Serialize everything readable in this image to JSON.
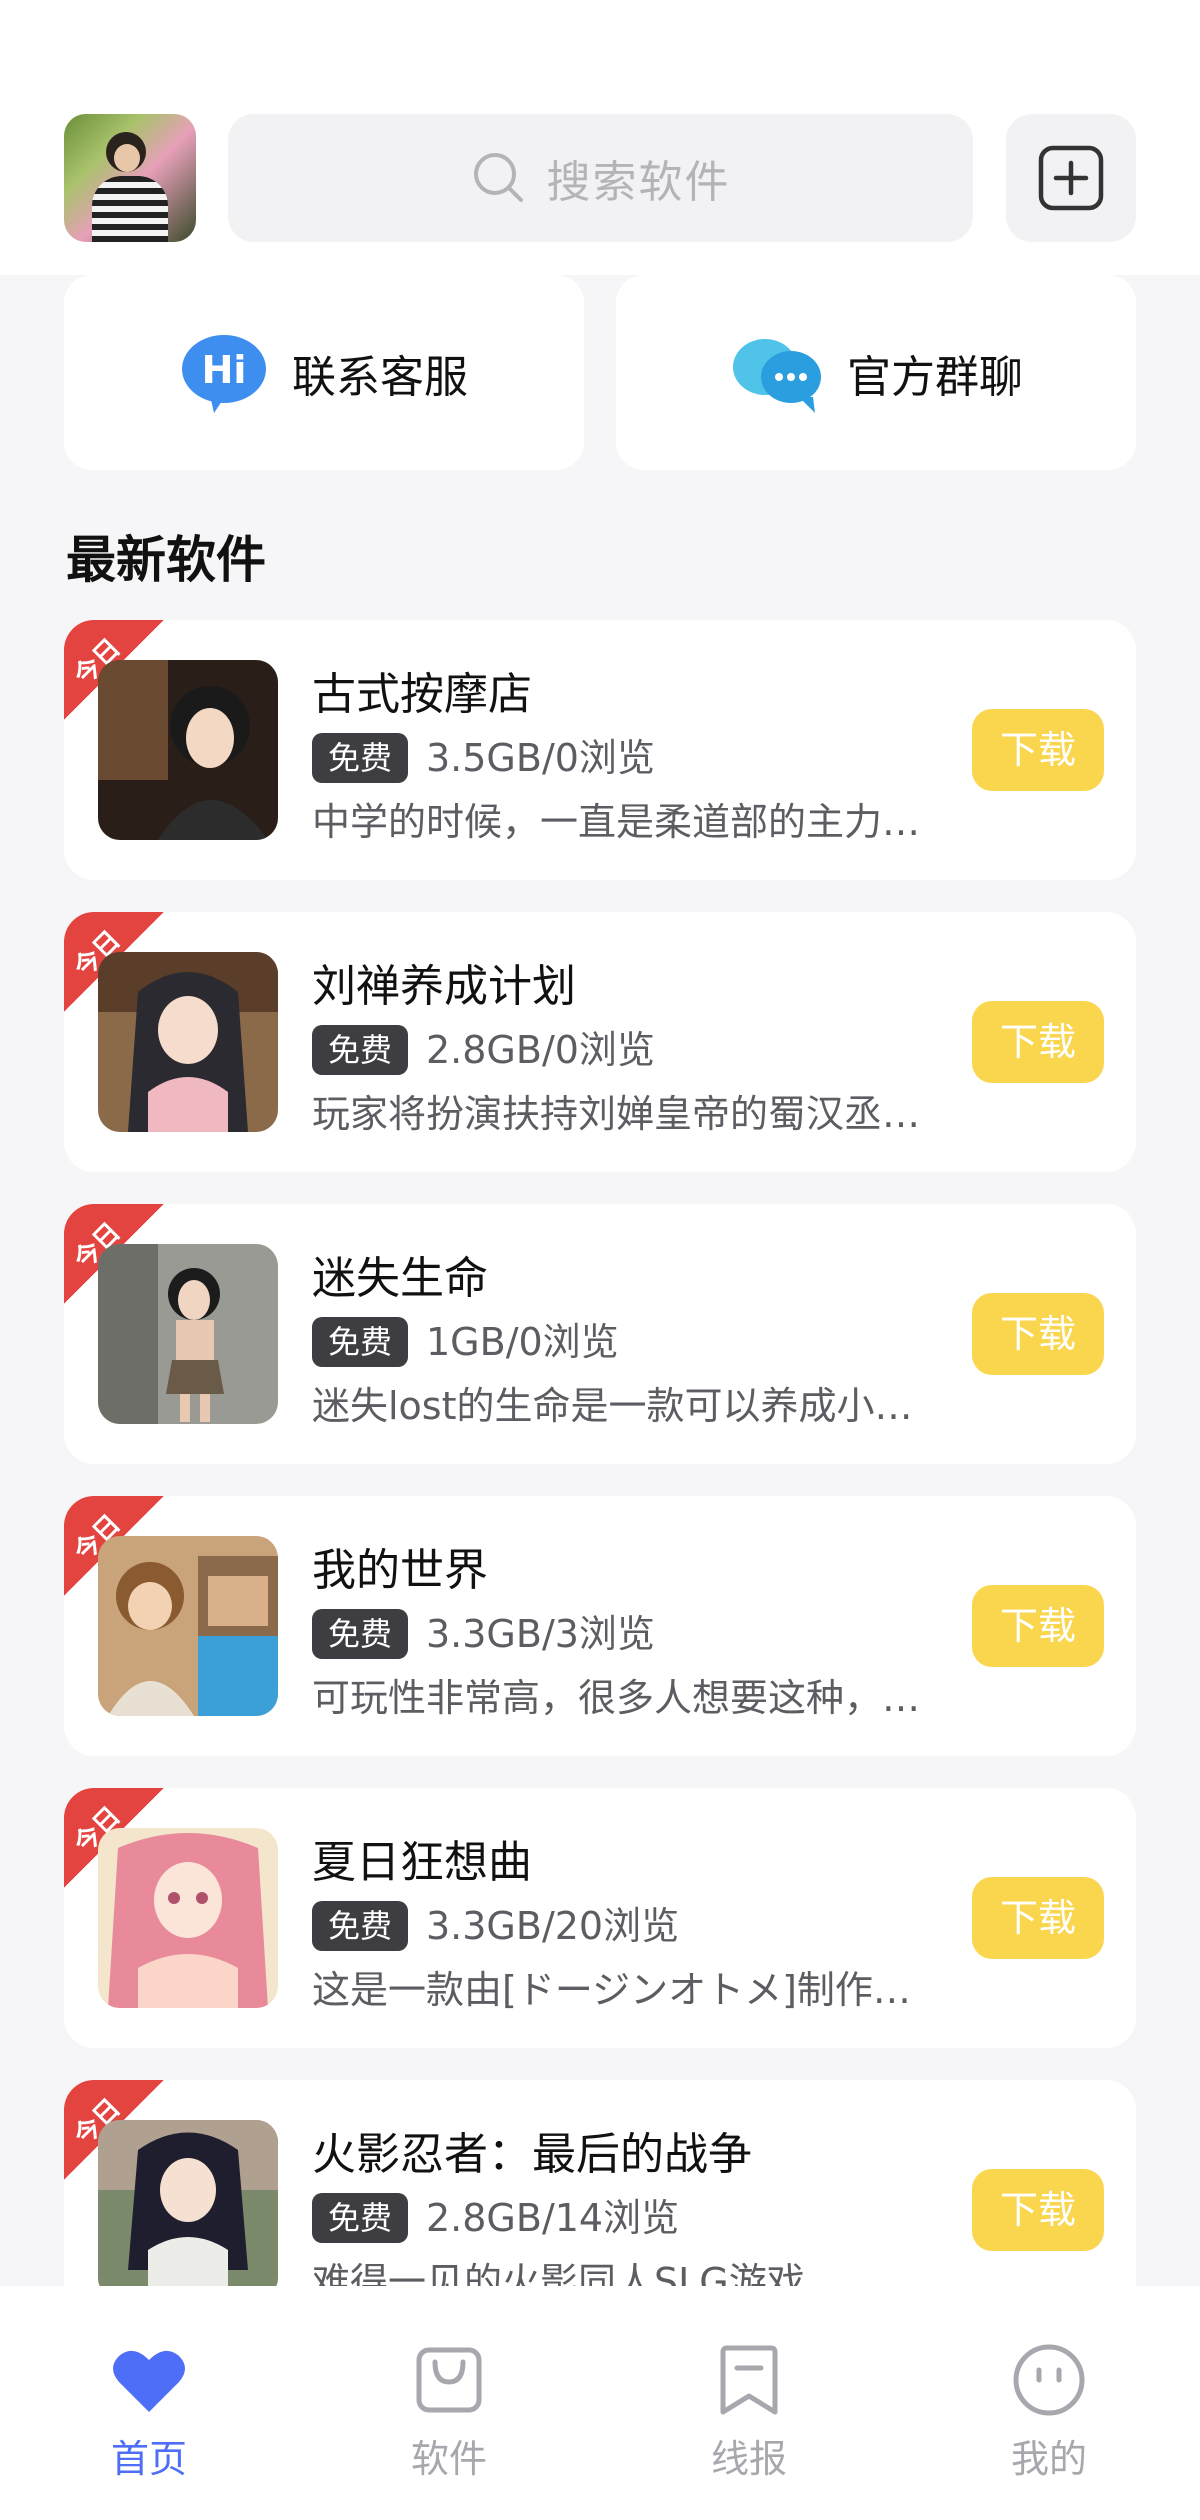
{
  "header": {
    "search_placeholder": "搜索软件"
  },
  "services": [
    {
      "label": "联系客服",
      "icon": "hi-chat-bubble-icon"
    },
    {
      "label": "官方群聊",
      "icon": "group-chat-bubbles-icon"
    }
  ],
  "section": {
    "title": "最新软件"
  },
  "items": [
    {
      "badge_corner": "今日",
      "title": "古式按摩店",
      "tag": "免费",
      "meta": "3.5GB/0浏览",
      "desc": "中学的时候，一直是柔道部的主力…",
      "button": "下载"
    },
    {
      "badge_corner": "今日",
      "title": "刘禅养成计划",
      "tag": "免费",
      "meta": "2.8GB/0浏览",
      "desc": "玩家将扮演扶持刘婵皇帝的蜀汉丞…",
      "button": "下载"
    },
    {
      "badge_corner": "今日",
      "title": "迷失生命",
      "tag": "免费",
      "meta": "1GB/0浏览",
      "desc": "迷失lost的生命是一款可以养成小…",
      "button": "下载"
    },
    {
      "badge_corner": "今日",
      "title": "我的世界",
      "tag": "免费",
      "meta": "3.3GB/3浏览",
      "desc": "可玩性非常高，很多人想要这种，…",
      "button": "下载"
    },
    {
      "badge_corner": "今日",
      "title": "夏日狂想曲",
      "tag": "免费",
      "meta": "3.3GB/20浏览",
      "desc": "这是一款由[ドージンオトメ]制作…",
      "button": "下载"
    },
    {
      "badge_corner": "今日",
      "title": "火影忍者：最后的战争",
      "tag": "免费",
      "meta": "2.8GB/14浏览",
      "desc": "难得一见的火影同人SLG游戏",
      "button": "下载"
    }
  ],
  "tabbar": [
    {
      "label": "首页",
      "icon": "heart-icon",
      "active": true
    },
    {
      "label": "软件",
      "icon": "bag-icon",
      "active": false
    },
    {
      "label": "线报",
      "icon": "bookmark-icon",
      "active": false
    },
    {
      "label": "我的",
      "icon": "face-icon",
      "active": false
    }
  ],
  "colors": {
    "accent": "#4f6ef7",
    "download": "#fad64e",
    "ribbon": "#e3443f",
    "tag": "#3e3e42"
  }
}
